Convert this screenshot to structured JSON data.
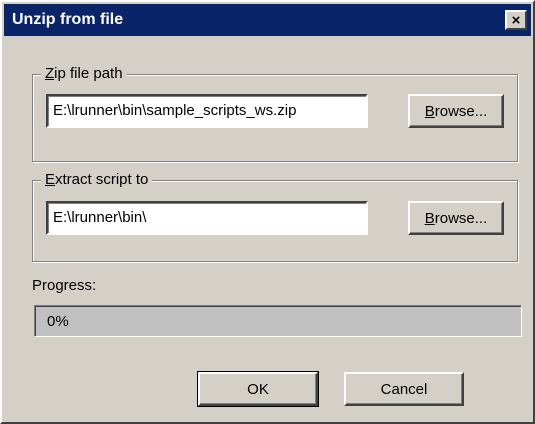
{
  "window": {
    "title": "Unzip from file",
    "close_glyph": "×"
  },
  "zip_group": {
    "label_prefix": "Z",
    "label_rest": "ip file path",
    "path_value": "E:\\lrunner\\bin\\sample_scripts_ws.zip",
    "browse_prefix": "B",
    "browse_rest": "rowse..."
  },
  "extract_group": {
    "label_prefix": "E",
    "label_rest": "xtract script to",
    "path_value": "E:\\lrunner\\bin\\",
    "browse_prefix": "B",
    "browse_rest": "rowse..."
  },
  "progress": {
    "label": "Progress:",
    "text": "0%",
    "value": 0
  },
  "buttons": {
    "ok_label": "OK",
    "cancel_label": "Cancel"
  },
  "colors": {
    "titlebar": "#0a246a",
    "face": "#d4d0c8"
  }
}
